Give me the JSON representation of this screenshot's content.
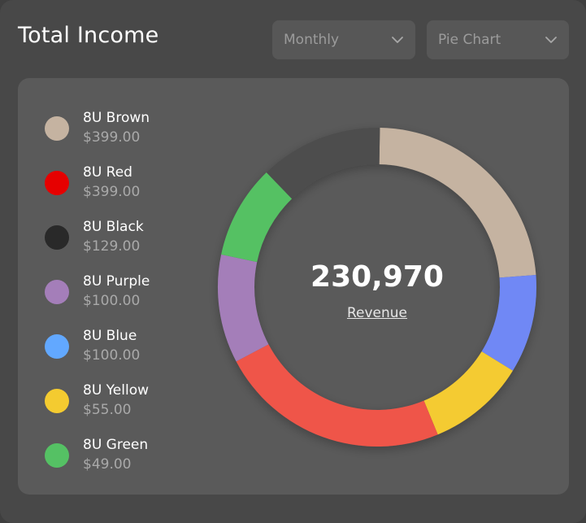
{
  "header": {
    "title": "Total Income",
    "period_dropdown": "Monthly",
    "type_dropdown": "Pie Chart"
  },
  "legend": [
    {
      "name": "8U Brown",
      "value": "$399.00",
      "color": "#c5b3a1"
    },
    {
      "name": "8U Red",
      "value": "$399.00",
      "color": "#e60000"
    },
    {
      "name": "8U Black",
      "value": "$129.00",
      "color": "#292929"
    },
    {
      "name": "8U Purple",
      "value": "$100.00",
      "color": "#a47eb9"
    },
    {
      "name": "8U Blue",
      "value": "$100.00",
      "color": "#62a8ff"
    },
    {
      "name": "8U Yellow",
      "value": "$55.00",
      "color": "#f4cb30"
    },
    {
      "name": "8U Green",
      "value": "$49.00",
      "color": "#55c164"
    }
  ],
  "center": {
    "value": "230,970",
    "label": "Revenue"
  },
  "chart_data": {
    "type": "pie",
    "style": "donut",
    "title": "",
    "slices": [
      {
        "color": "#c5b3a1",
        "percent": 23.5
      },
      {
        "color": "#6f88f5",
        "percent": 10.0
      },
      {
        "color": "#f4cb30",
        "percent": 10.0
      },
      {
        "color": "#ef5548",
        "percent": 23.5
      },
      {
        "color": "#a47eb9",
        "percent": 11.0
      },
      {
        "color": "#55c164",
        "percent": 9.5
      },
      {
        "color": "#4d4d4d",
        "percent": 12.5
      }
    ]
  }
}
